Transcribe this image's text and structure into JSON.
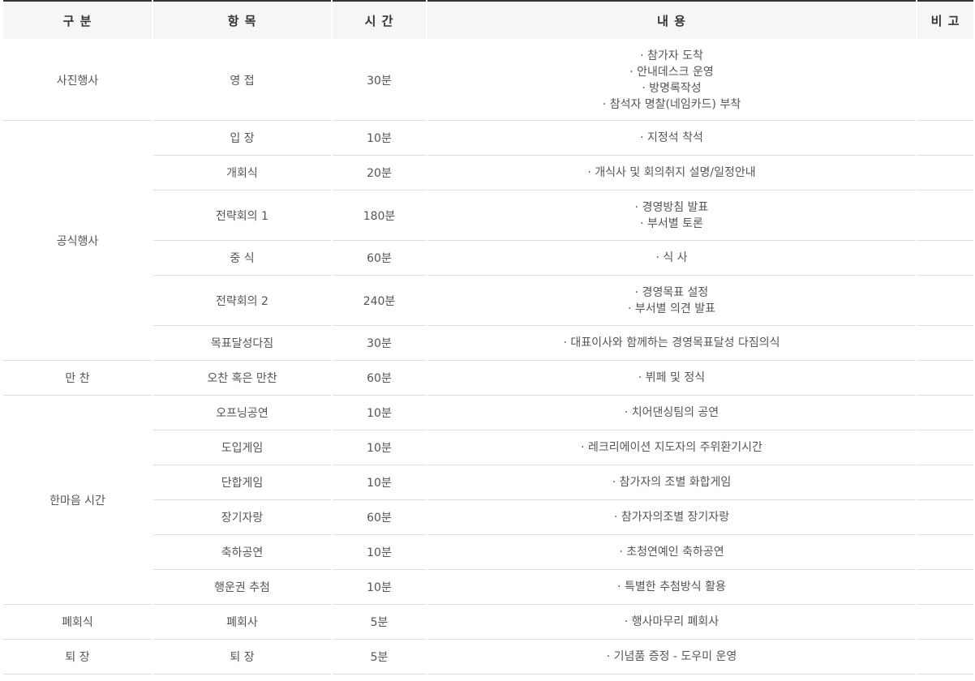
{
  "table": {
    "headers": [
      "구 분",
      "항 목",
      "시 간",
      "내 용",
      "비 고"
    ],
    "groups": [
      {
        "category": "사진행사",
        "rows": [
          {
            "item": "영 접",
            "time": "30분",
            "content": [
              "· 참가자 도착",
              "· 안내데스크 운영",
              "· 방명록작성",
              "· 참석자 명찰(네임카드) 부착"
            ],
            "note": ""
          }
        ]
      },
      {
        "category": "공식행사",
        "rows": [
          {
            "item": "입 장",
            "time": "10분",
            "content": [
              "· 지정석 착석"
            ],
            "note": ""
          },
          {
            "item": "개회식",
            "time": "20분",
            "content": [
              "· 개식사 및 회의취지 설명/일정안내"
            ],
            "note": ""
          },
          {
            "item": "전략회의 1",
            "time": "180분",
            "content": [
              "· 경영방침 발표",
              "· 부서별 토론"
            ],
            "note": ""
          },
          {
            "item": "중 식",
            "time": "60분",
            "content": [
              "· 식 사"
            ],
            "note": ""
          },
          {
            "item": "전략회의 2",
            "time": "240분",
            "content": [
              "· 경영목표 설정",
              "· 부서별 의견 발표"
            ],
            "note": ""
          },
          {
            "item": "목표달성다짐",
            "time": "30분",
            "content": [
              "· 대표이사와 함께하는 경영목표달성 다짐의식"
            ],
            "note": ""
          }
        ]
      },
      {
        "category": "만 찬",
        "rows": [
          {
            "item": "오찬 혹은 만찬",
            "time": "60분",
            "content": [
              "· 뷔페 및 정식"
            ],
            "note": ""
          }
        ]
      },
      {
        "category": "한마음 시간",
        "rows": [
          {
            "item": "오프닝공연",
            "time": "10분",
            "content": [
              "· 치어댄싱팀의 공연"
            ],
            "note": ""
          },
          {
            "item": "도입게임",
            "time": "10분",
            "content": [
              "· 레크리에이션 지도자의 주위환기시간"
            ],
            "note": ""
          },
          {
            "item": "단합게임",
            "time": "10분",
            "content": [
              "· 참가자의 조별 화합게임"
            ],
            "note": ""
          },
          {
            "item": "장기자랑",
            "time": "60분",
            "content": [
              "· 참가자의조별 장기자랑"
            ],
            "note": ""
          },
          {
            "item": "축하공연",
            "time": "10분",
            "content": [
              "· 초청연예인 축하공연"
            ],
            "note": ""
          },
          {
            "item": "행운권 추첨",
            "time": "10분",
            "content": [
              "· 특별한 추첨방식 활용"
            ],
            "note": ""
          }
        ]
      },
      {
        "category": "폐회식",
        "rows": [
          {
            "item": "폐회사",
            "time": "5분",
            "content": [
              "· 행사마무리 폐회사"
            ],
            "note": ""
          }
        ]
      },
      {
        "category": "퇴 장",
        "rows": [
          {
            "item": "퇴 장",
            "time": "5분",
            "content": [
              "· 기념품 증정 - 도우미 운영"
            ],
            "note": ""
          }
        ]
      }
    ]
  }
}
